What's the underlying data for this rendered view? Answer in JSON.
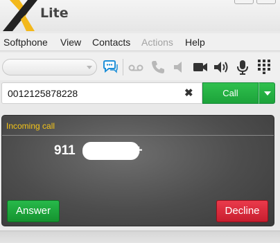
{
  "app": {
    "title": "Lite"
  },
  "menu": {
    "items": [
      {
        "label": "Softphone",
        "disabled": false
      },
      {
        "label": "View",
        "disabled": false
      },
      {
        "label": "Contacts",
        "disabled": false
      },
      {
        "label": "Actions",
        "disabled": true
      },
      {
        "label": "Help",
        "disabled": false
      }
    ]
  },
  "toolbar": {
    "status_value": "",
    "icons": [
      "chat-icon",
      "voicemail-icon",
      "phone-icon",
      "speaker-mute-icon",
      "video-icon",
      "volume-icon",
      "microphone-icon",
      "dialpad-icon"
    ]
  },
  "dial": {
    "number": "0012125878228",
    "clear_label": "✖",
    "call_label": "Call"
  },
  "incoming": {
    "title": "Incoming call",
    "caller": "911",
    "caller_suffix": "+",
    "answer_label": "Answer",
    "decline_label": "Decline"
  },
  "colors": {
    "call_green": "#1ca33a",
    "decline_red": "#c81e2f",
    "incoming_title": "#f5c518"
  }
}
